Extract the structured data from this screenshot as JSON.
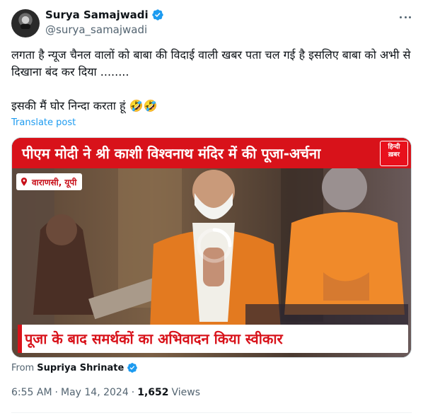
{
  "author": {
    "display_name": "Surya Samajwadi",
    "handle": "@surya_samajwadi",
    "verified_icon": "verified-badge-icon"
  },
  "tweet": {
    "text": "लगता है न्यूज चैनल वालों को बाबा की विदाई वाली खबर पता चल गई है इसलिए बाबा को अभी से दिखाना बंद कर दिया ........\n\nइसकी मैं घोर निन्दा करता हूं 🤣🤣",
    "translate_label": "Translate post"
  },
  "media": {
    "top_banner": "पीएम मोदी ने श्री काशी विश्वनाथ मंदिर में की पूजा-अर्चना",
    "logo": [
      "हिन्दी",
      "ख़बर"
    ],
    "location": "वाराणसी, यूपी",
    "bottom_banner": "पूजा के बाद समर्थकों का अभिवादन किया स्वीकार",
    "colors": {
      "banner_red": "#d8121a"
    }
  },
  "source": {
    "from_label": "From",
    "name": "Supriya Shrinate"
  },
  "meta": {
    "time": "6:55 AM",
    "separator1": "·",
    "date": "May 14, 2024",
    "separator2": "·",
    "views_count": "1,652",
    "views_label": "Views"
  },
  "colors": {
    "accent": "#1d9bf0",
    "text_primary": "#0f1419",
    "text_secondary": "#536471"
  }
}
